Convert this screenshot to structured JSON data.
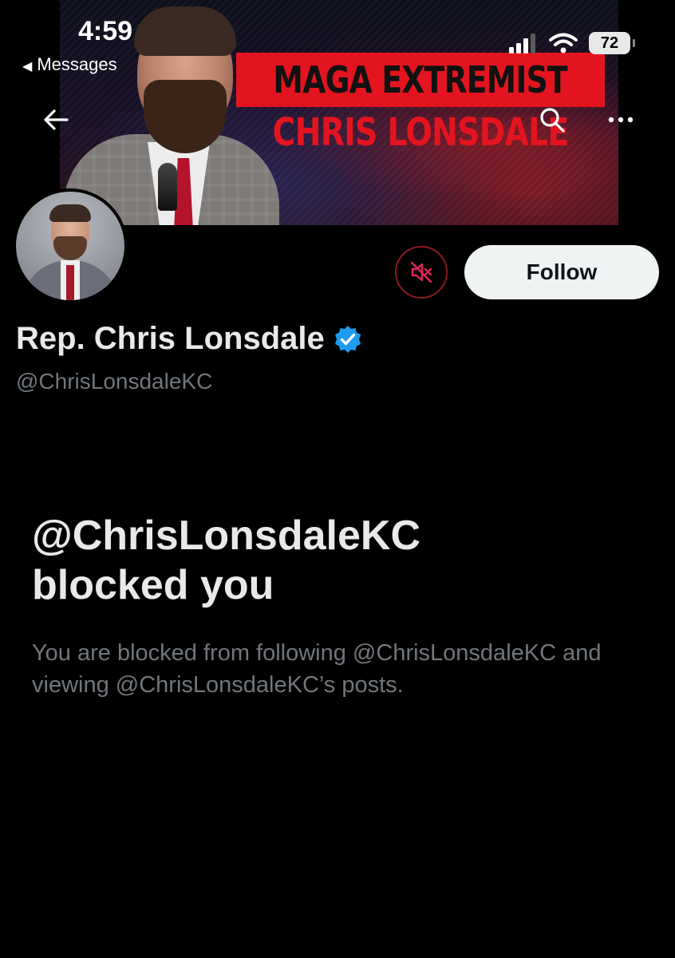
{
  "status_bar": {
    "time": "4:59",
    "back_app_label": "Messages",
    "battery_level": "72"
  },
  "banner": {
    "line1": "MAGA EXTREMIST",
    "line2": "CHRIS LONSDALE",
    "accent_color": "#e3141f"
  },
  "profile": {
    "display_name": "Rep. Chris Lonsdale",
    "handle": "@ChrisLonsdaleKC",
    "verified": true,
    "verified_color": "#1d9bf0"
  },
  "actions": {
    "follow_label": "Follow",
    "muted_icon": "speaker-muted-icon"
  },
  "blocked_notice": {
    "title_line1": "@ChrisLonsdaleKC",
    "title_line2": "blocked you",
    "description": "You are blocked from following @ChrisLonsdaleKC and viewing @ChrisLonsdaleKC’s posts."
  }
}
